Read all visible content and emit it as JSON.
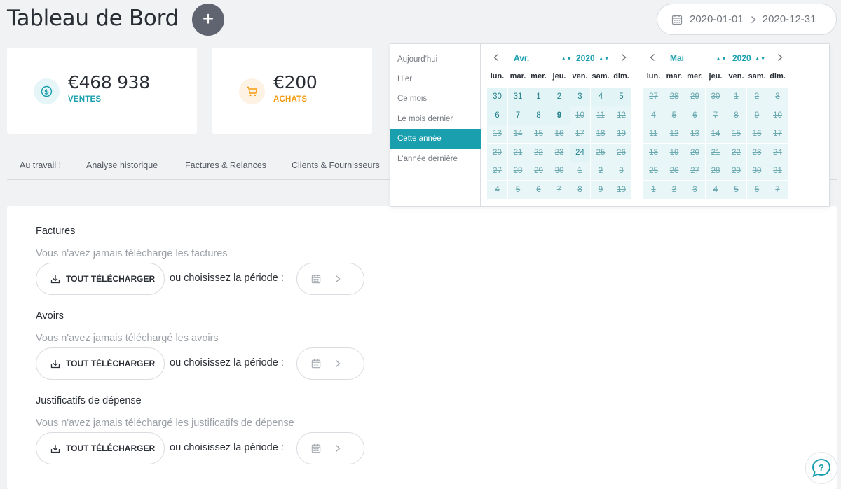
{
  "header": {
    "title": "Tableau de Bord",
    "add_label": "+"
  },
  "date_range": {
    "start": "2020-01-01",
    "end": "2020-12-31"
  },
  "cards": [
    {
      "value": "€468 938",
      "label": "VENTES",
      "color": "#1a9fae"
    },
    {
      "value": "€200",
      "label": "ACHATS",
      "color": "#f39c12"
    }
  ],
  "tabs": [
    "Au travail !",
    "Analyse historique",
    "Factures & Relances",
    "Clients & Fournisseurs"
  ],
  "sections": [
    {
      "title": "Factures",
      "subtitle": "Vous n'avez jamais téléchargé les factures",
      "button": "TOUT TÉLÉCHARGER",
      "or_text": "ou  choisissez la période :"
    },
    {
      "title": "Avoirs",
      "subtitle": "Vous n'avez jamais téléchargé les avoirs",
      "button": "TOUT TÉLÉCHARGER",
      "or_text": "ou  choisissez la période :"
    },
    {
      "title": "Justificatifs de dépense",
      "subtitle": "Vous n'avez jamais téléchargé les justificatifs de dépense",
      "button": "TOUT TÉLÉCHARGER",
      "or_text": "ou  choisissez la période :"
    }
  ],
  "datepicker": {
    "presets": [
      "Aujourd'hui",
      "Hier",
      "Ce mois",
      "Le mois dernier",
      "Cette année",
      "L'année dernière"
    ],
    "active_preset": "Cette année",
    "weekdays": [
      "lun.",
      "mar.",
      "mer.",
      "jeu.",
      "ven.",
      "sam.",
      "dim."
    ],
    "months": [
      {
        "month": "Avr.",
        "year": "2020",
        "weeks": [
          [
            [
              "30",
              "in"
            ],
            [
              "31",
              "in"
            ],
            [
              "1",
              "in"
            ],
            [
              "2",
              "in"
            ],
            [
              "3",
              "in"
            ],
            [
              "4",
              "in"
            ],
            [
              "5",
              "in"
            ]
          ],
          [
            [
              "6",
              "in"
            ],
            [
              "7",
              "in"
            ],
            [
              "8",
              "in"
            ],
            [
              "9",
              "today"
            ],
            [
              "10",
              "st"
            ],
            [
              "11",
              "st"
            ],
            [
              "12",
              "st"
            ]
          ],
          [
            [
              "13",
              "st"
            ],
            [
              "14",
              "st"
            ],
            [
              "15",
              "st"
            ],
            [
              "16",
              "st"
            ],
            [
              "17",
              "st"
            ],
            [
              "18",
              "st"
            ],
            [
              "19",
              "st"
            ]
          ],
          [
            [
              "20",
              "st"
            ],
            [
              "21",
              "st"
            ],
            [
              "22",
              "st"
            ],
            [
              "23",
              "st"
            ],
            [
              "24",
              "in"
            ],
            [
              "25",
              "st"
            ],
            [
              "26",
              "st"
            ]
          ],
          [
            [
              "27",
              "st"
            ],
            [
              "28",
              "st"
            ],
            [
              "29",
              "st"
            ],
            [
              "30",
              "st"
            ],
            [
              "1",
              "st"
            ],
            [
              "2",
              "st"
            ],
            [
              "3",
              "st"
            ]
          ],
          [
            [
              "4",
              "st"
            ],
            [
              "5",
              "st"
            ],
            [
              "6",
              "st"
            ],
            [
              "7",
              "st"
            ],
            [
              "8",
              "st"
            ],
            [
              "9",
              "st"
            ],
            [
              "10",
              "st"
            ]
          ]
        ]
      },
      {
        "month": "Mai",
        "year": "2020",
        "weeks": [
          [
            [
              "27",
              "st"
            ],
            [
              "28",
              "st"
            ],
            [
              "29",
              "st"
            ],
            [
              "30",
              "st"
            ],
            [
              "1",
              "st"
            ],
            [
              "2",
              "st"
            ],
            [
              "3",
              "st"
            ]
          ],
          [
            [
              "4",
              "st"
            ],
            [
              "5",
              "st"
            ],
            [
              "6",
              "st"
            ],
            [
              "7",
              "st"
            ],
            [
              "8",
              "st"
            ],
            [
              "9",
              "st"
            ],
            [
              "10",
              "st"
            ]
          ],
          [
            [
              "11",
              "st"
            ],
            [
              "12",
              "st"
            ],
            [
              "13",
              "st"
            ],
            [
              "14",
              "st"
            ],
            [
              "15",
              "st"
            ],
            [
              "16",
              "st"
            ],
            [
              "17",
              "st"
            ]
          ],
          [
            [
              "18",
              "st"
            ],
            [
              "19",
              "st"
            ],
            [
              "20",
              "st"
            ],
            [
              "21",
              "st"
            ],
            [
              "22",
              "st"
            ],
            [
              "23",
              "st"
            ],
            [
              "24",
              "st"
            ]
          ],
          [
            [
              "25",
              "st"
            ],
            [
              "26",
              "st"
            ],
            [
              "27",
              "st"
            ],
            [
              "28",
              "st"
            ],
            [
              "29",
              "st"
            ],
            [
              "30",
              "st"
            ],
            [
              "31",
              "st"
            ]
          ],
          [
            [
              "1",
              "st"
            ],
            [
              "2",
              "st"
            ],
            [
              "3",
              "st"
            ],
            [
              "4",
              "st"
            ],
            [
              "5",
              "st"
            ],
            [
              "6",
              "st"
            ],
            [
              "7",
              "st"
            ]
          ]
        ]
      }
    ]
  },
  "help_label": "?"
}
